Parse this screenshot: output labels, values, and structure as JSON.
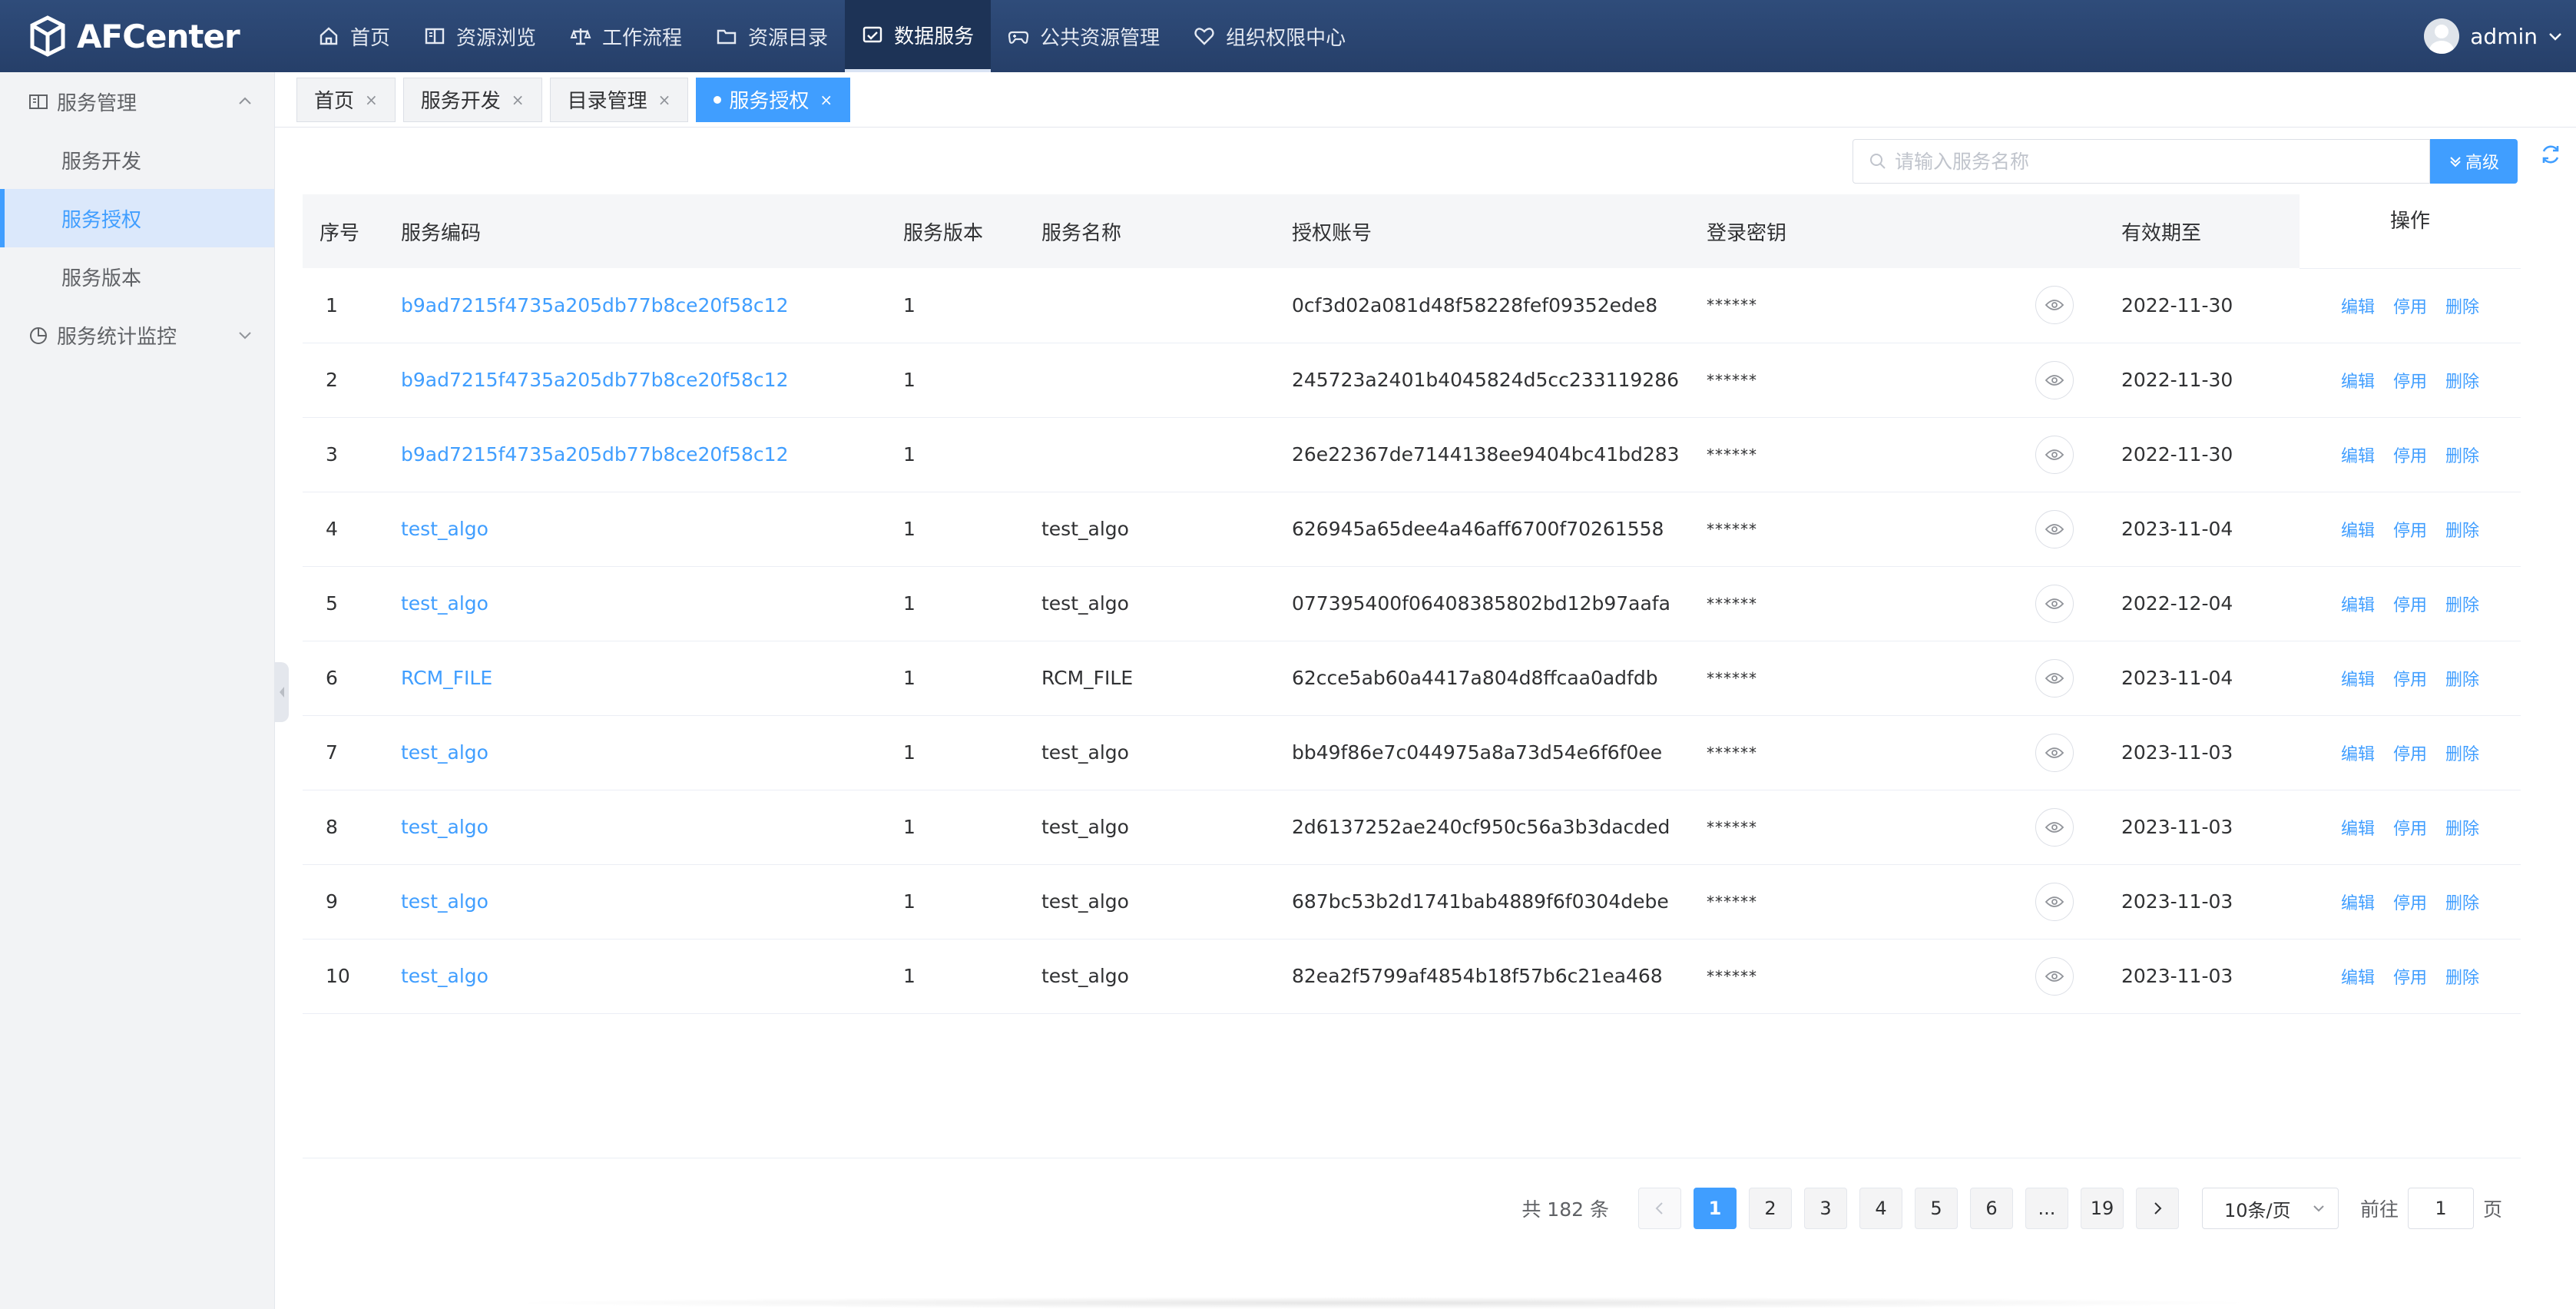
{
  "app": {
    "title": "AFCenter"
  },
  "nav": [
    {
      "label": "首页",
      "icon": "home-icon"
    },
    {
      "label": "资源浏览",
      "icon": "book-icon"
    },
    {
      "label": "工作流程",
      "icon": "scale-icon"
    },
    {
      "label": "资源目录",
      "icon": "folder-icon"
    },
    {
      "label": "数据服务",
      "icon": "data-service-icon",
      "active": true
    },
    {
      "label": "公共资源管理",
      "icon": "gamepad-icon"
    },
    {
      "label": "组织权限中心",
      "icon": "heart-icon"
    }
  ],
  "user": {
    "name": "admin"
  },
  "sidebar": {
    "group1": {
      "label": "服务管理"
    },
    "items": [
      {
        "label": "服务开发"
      },
      {
        "label": "服务授权",
        "active": true
      },
      {
        "label": "服务版本"
      }
    ],
    "group2": {
      "label": "服务统计监控"
    }
  },
  "tabs": [
    {
      "label": "首页",
      "close": "×"
    },
    {
      "label": "服务开发",
      "close": "×"
    },
    {
      "label": "目录管理",
      "close": "×"
    },
    {
      "label": "服务授权",
      "close": "×",
      "active": true
    }
  ],
  "search": {
    "placeholder": "请输入服务名称",
    "value": ""
  },
  "toolbar": {
    "advanced_label": "高级"
  },
  "table": {
    "columns": {
      "index": "序号",
      "code": "服务编码",
      "version": "服务版本",
      "name": "服务名称",
      "account": "授权账号",
      "password": "登录密钥",
      "expire": "有效期至",
      "ops": "操作"
    },
    "actions": {
      "edit": "编辑",
      "disable": "停用",
      "delete": "删除"
    },
    "rows": [
      {
        "index": "1",
        "code": "b9ad7215f4735a205db77b8ce20f58c12",
        "version": "1",
        "name": "",
        "account": "0cf3d02a081d48f58228fef09352ede8",
        "password": "******",
        "expire": "2022-11-30"
      },
      {
        "index": "2",
        "code": "b9ad7215f4735a205db77b8ce20f58c12",
        "version": "1",
        "name": "",
        "account": "245723a2401b4045824d5cc233119286",
        "password": "******",
        "expire": "2022-11-30"
      },
      {
        "index": "3",
        "code": "b9ad7215f4735a205db77b8ce20f58c12",
        "version": "1",
        "name": "",
        "account": "26e22367de7144138ee9404bc41bd283",
        "password": "******",
        "expire": "2022-11-30"
      },
      {
        "index": "4",
        "code": "test_algo",
        "version": "1",
        "name": "test_algo",
        "account": "626945a65dee4a46aff6700f70261558",
        "password": "******",
        "expire": "2023-11-04"
      },
      {
        "index": "5",
        "code": "test_algo",
        "version": "1",
        "name": "test_algo",
        "account": "077395400f06408385802bd12b97aafa",
        "password": "******",
        "expire": "2022-12-04"
      },
      {
        "index": "6",
        "code": "RCM_FILE",
        "version": "1",
        "name": "RCM_FILE",
        "account": "62cce5ab60a4417a804d8ffcaa0adfdb",
        "password": "******",
        "expire": "2023-11-04"
      },
      {
        "index": "7",
        "code": "test_algo",
        "version": "1",
        "name": "test_algo",
        "account": "bb49f86e7c044975a8a73d54e6f6f0ee",
        "password": "******",
        "expire": "2023-11-03"
      },
      {
        "index": "8",
        "code": "test_algo",
        "version": "1",
        "name": "test_algo",
        "account": "2d6137252ae240cf950c56a3b3dacded",
        "password": "******",
        "expire": "2023-11-03"
      },
      {
        "index": "9",
        "code": "test_algo",
        "version": "1",
        "name": "test_algo",
        "account": "687bc53b2d1741bab4889f6f0304debe",
        "password": "******",
        "expire": "2023-11-03"
      },
      {
        "index": "10",
        "code": "test_algo",
        "version": "1",
        "name": "test_algo",
        "account": "82ea2f5799af4854b18f57b6c21ea468",
        "password": "******",
        "expire": "2023-11-03"
      }
    ]
  },
  "pagination": {
    "total_label": "共 182 条",
    "pages": [
      "1",
      "2",
      "3",
      "4",
      "5",
      "6",
      "...",
      "19"
    ],
    "current": "1",
    "page_size": "10条/页",
    "goto_prefix": "前往",
    "goto_value": "1",
    "goto_suffix": "页"
  },
  "colors": {
    "primary": "#409eff",
    "nav_bg": "#2b4675",
    "sidebar_bg": "#f2f3f5"
  }
}
